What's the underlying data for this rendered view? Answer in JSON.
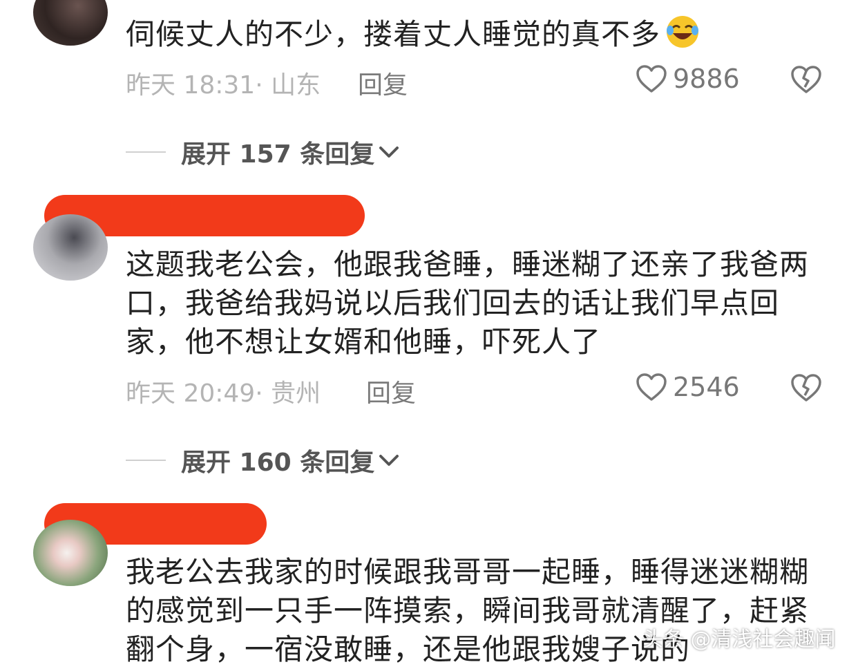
{
  "comments": [
    {
      "text": "伺候丈人的不少，搂着丈人睡觉的真不多",
      "emoji": "rolling-laughing-emoji",
      "meta": "昨天 18:31· 山东",
      "reply_label": "回复",
      "likes": "9886",
      "expand_label": "展开 157 条回复"
    },
    {
      "text": "这题我老公会，他跟我爸睡，睡迷糊了还亲了我爸两口，我爸给我妈说以后我们回去的话让我们早点回家，他不想让女婿和他睡，吓死人了",
      "meta": "昨天 20:49· 贵州",
      "reply_label": "回复",
      "likes": "2546",
      "expand_label": "展开 160 条回复"
    },
    {
      "text": "我老公去我家的时候跟我哥哥一起睡，睡得迷迷糊糊的感觉到一只手一阵摸索，瞬间我哥就清醒了，赶紧翻个身，一宿没敢睡，还是他跟我嫂子说的"
    }
  ],
  "watermark": "头条 @清浅社会趣闻",
  "colors": {
    "redaction": "#f23a1a",
    "text": "#222222",
    "meta": "#b4b4b4"
  }
}
